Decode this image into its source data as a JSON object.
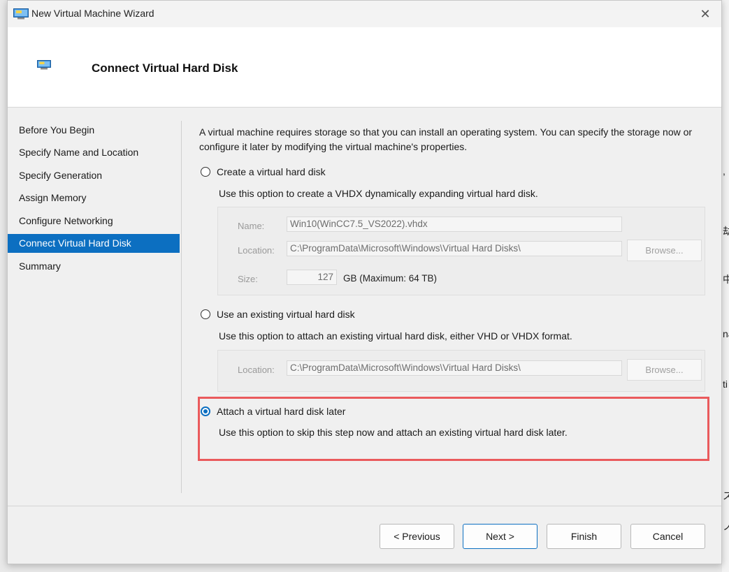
{
  "window": {
    "title": "New Virtual Machine Wizard",
    "close_glyph": "✕"
  },
  "header": {
    "title": "Connect Virtual Hard Disk"
  },
  "steps": [
    "Before You Begin",
    "Specify Name and Location",
    "Specify Generation",
    "Assign Memory",
    "Configure Networking",
    "Connect Virtual Hard Disk",
    "Summary"
  ],
  "active_step": "Connect Virtual Hard Disk",
  "intro": "A virtual machine requires storage so that you can install an operating system. You can specify the storage now or configure it later by modifying the virtual machine's properties.",
  "option_create": {
    "label": "Create a virtual hard disk",
    "selected": false,
    "description": "Use this option to create a VHDX dynamically expanding virtual hard disk.",
    "name_label": "Name:",
    "name_value": "Win10(WinCC7.5_VS2022).vhdx",
    "location_label": "Location:",
    "location_value": "C:\\ProgramData\\Microsoft\\Windows\\Virtual Hard Disks\\",
    "browse_label": "Browse...",
    "size_label": "Size:",
    "size_value": "127",
    "size_unit": "GB (Maximum: 64 TB)"
  },
  "option_existing": {
    "label": "Use an existing virtual hard disk",
    "selected": false,
    "description": "Use this option to attach an existing virtual hard disk, either VHD or VHDX format.",
    "location_label": "Location:",
    "location_value": "C:\\ProgramData\\Microsoft\\Windows\\Virtual Hard Disks\\",
    "browse_label": "Browse..."
  },
  "option_later": {
    "label": "Attach a virtual hard disk later",
    "selected": true,
    "description": "Use this option to skip this step now and attach an existing virtual hard disk later."
  },
  "buttons": {
    "previous": "< Previous",
    "next": "Next >",
    "finish": "Finish",
    "cancel": "Cancel"
  },
  "background_chars": [
    ",",
    "劫",
    "中",
    "na",
    "ti",
    "ス",
    "ノ"
  ],
  "colors": {
    "accent": "#0c6fc1",
    "highlight": "#ea5a5c"
  }
}
